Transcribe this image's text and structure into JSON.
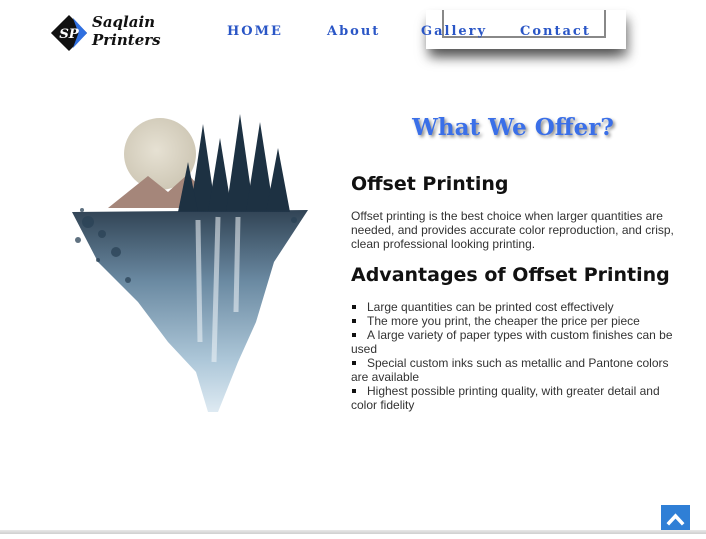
{
  "brand": {
    "name_line1": "Saqlain",
    "name_line2": "Printers",
    "monogram": "SP"
  },
  "nav": {
    "home": "HOME",
    "about": "About",
    "gallery": "Gallery",
    "contact": "Contact"
  },
  "section": {
    "title": "What We Offer?",
    "offset_heading": "Offset Printing",
    "offset_text": "Offset printing is the best choice when larger quantities are needed, and provides accurate color reproduction, and crisp, clean professional looking printing.",
    "advantages_heading": "Advantages of Offset Printing",
    "advantages": [
      "Large quantities can be printed cost effectively",
      "The more you print, the cheaper the price per piece",
      "A large variety of paper types with custom finishes can be used",
      "Special custom inks such as metallic and Pantone colors are available",
      "Highest possible printing quality, with greater detail and color fidelity"
    ]
  },
  "icons": {
    "back_to_top": "chevron-up-icon",
    "illustration": "watercolor-island-image"
  },
  "colors": {
    "nav": "#2a56c6",
    "title": "#3a6fe8",
    "back_to_top": "#2f7fd6"
  }
}
